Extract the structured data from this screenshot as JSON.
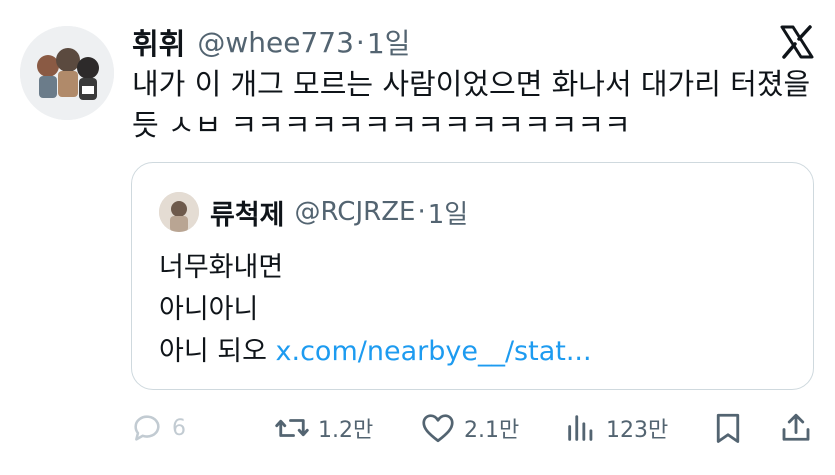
{
  "tweet": {
    "display_name": "휘휘",
    "handle": "@whee773",
    "separator": "·",
    "time": "1일",
    "text_line1": "내가 이 개그 모르는 사람이었으면 화나서 대가리 터졌을",
    "text_line2": "듯 ㅅㅂ ㅋㅋㅋㅋㅋㅋㅋㅋㅋㅋㅋㅋㅋㅋㅋ"
  },
  "quote": {
    "display_name": "류척제",
    "handle": "@RCJRZE",
    "separator": "·",
    "time": "1일",
    "line1": "너무화내면",
    "line2": "아니아니",
    "line3_prefix": "아니 되오 ",
    "link": "x.com/nearbye__/stat..."
  },
  "actions": {
    "replies": "6",
    "retweets": "1.2만",
    "likes": "2.1만",
    "views": "123만"
  },
  "icons": {
    "brand": "x-logo-icon",
    "reply": "reply-icon",
    "retweet": "retweet-icon",
    "like": "heart-icon",
    "views": "views-bar-icon",
    "bookmark": "bookmark-icon",
    "share": "share-icon"
  },
  "colors": {
    "text": "#0f1419",
    "muted": "#536471",
    "link": "#1d9bf0",
    "border": "#cfd9de"
  }
}
